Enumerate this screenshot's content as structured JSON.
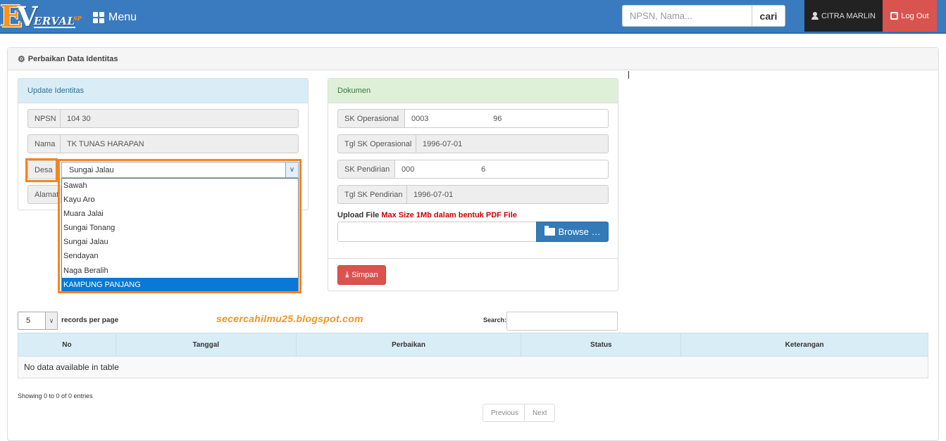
{
  "navbar": {
    "logo_e": "E",
    "logo_v": "V",
    "logo_word": "ERVAL",
    "logo_sup": "SP",
    "menu_label": "Menu",
    "search_placeholder": "NPSN, Nama...",
    "search_button": "cari",
    "user_name": "CITRA MARLIN",
    "logout_label": "Log Out",
    "bg_color": "#3a7bbf",
    "logout_color": "#d9534f"
  },
  "page": {
    "heading": "Perbaikan Data Identitas"
  },
  "identity": {
    "title": "Update Identitas",
    "npsn_label": "NPSN",
    "npsn_value": "104       30",
    "nama_label": "Nama",
    "nama_value": "TK TUNAS HARAPAN",
    "desa_label": "Desa",
    "desa_selected": "Sungai Jalau",
    "alamat_label": "Alamat",
    "desa_options": [
      "Sawah",
      "Kayu Aro",
      "Muara Jalai",
      "Sungai Tonang",
      "Sungai Jalau",
      "Sendayan",
      "Naga Beralih",
      "KAMPUNG PANJANG"
    ],
    "highlight_color": "#f7831f"
  },
  "dokumen": {
    "title": "Dokumen",
    "sk_operasional_label": "SK Operasional",
    "sk_operasional_value": "0003                              96",
    "tgl_sk_operasional_label": "Tgl SK Operasional",
    "tgl_sk_operasional_value": "1996-07-01",
    "sk_pendirian_label": "SK Pendirian",
    "sk_pendirian_value": "000                               6",
    "tgl_sk_pendirian_label": "Tgl SK Pendirian",
    "tgl_sk_pendirian_value": "1996-07-01",
    "upload_label": "Upload File",
    "upload_note": "Max Size 1Mb dalam bentuk PDF File",
    "browse_label": "Browse …",
    "simpan_label": "Simpan"
  },
  "table": {
    "length_value": "5",
    "length_label": "records per page",
    "watermark": "secercahilmu25.blogspot.com",
    "search_label": "Search:",
    "columns": [
      "No",
      "Tanggal",
      "Perbaikan",
      "Status",
      "Keterangan"
    ],
    "empty_message": "No data available in table",
    "info": "Showing 0 to 0 of 0 entries",
    "prev_label": "Previous",
    "next_label": "Next"
  }
}
